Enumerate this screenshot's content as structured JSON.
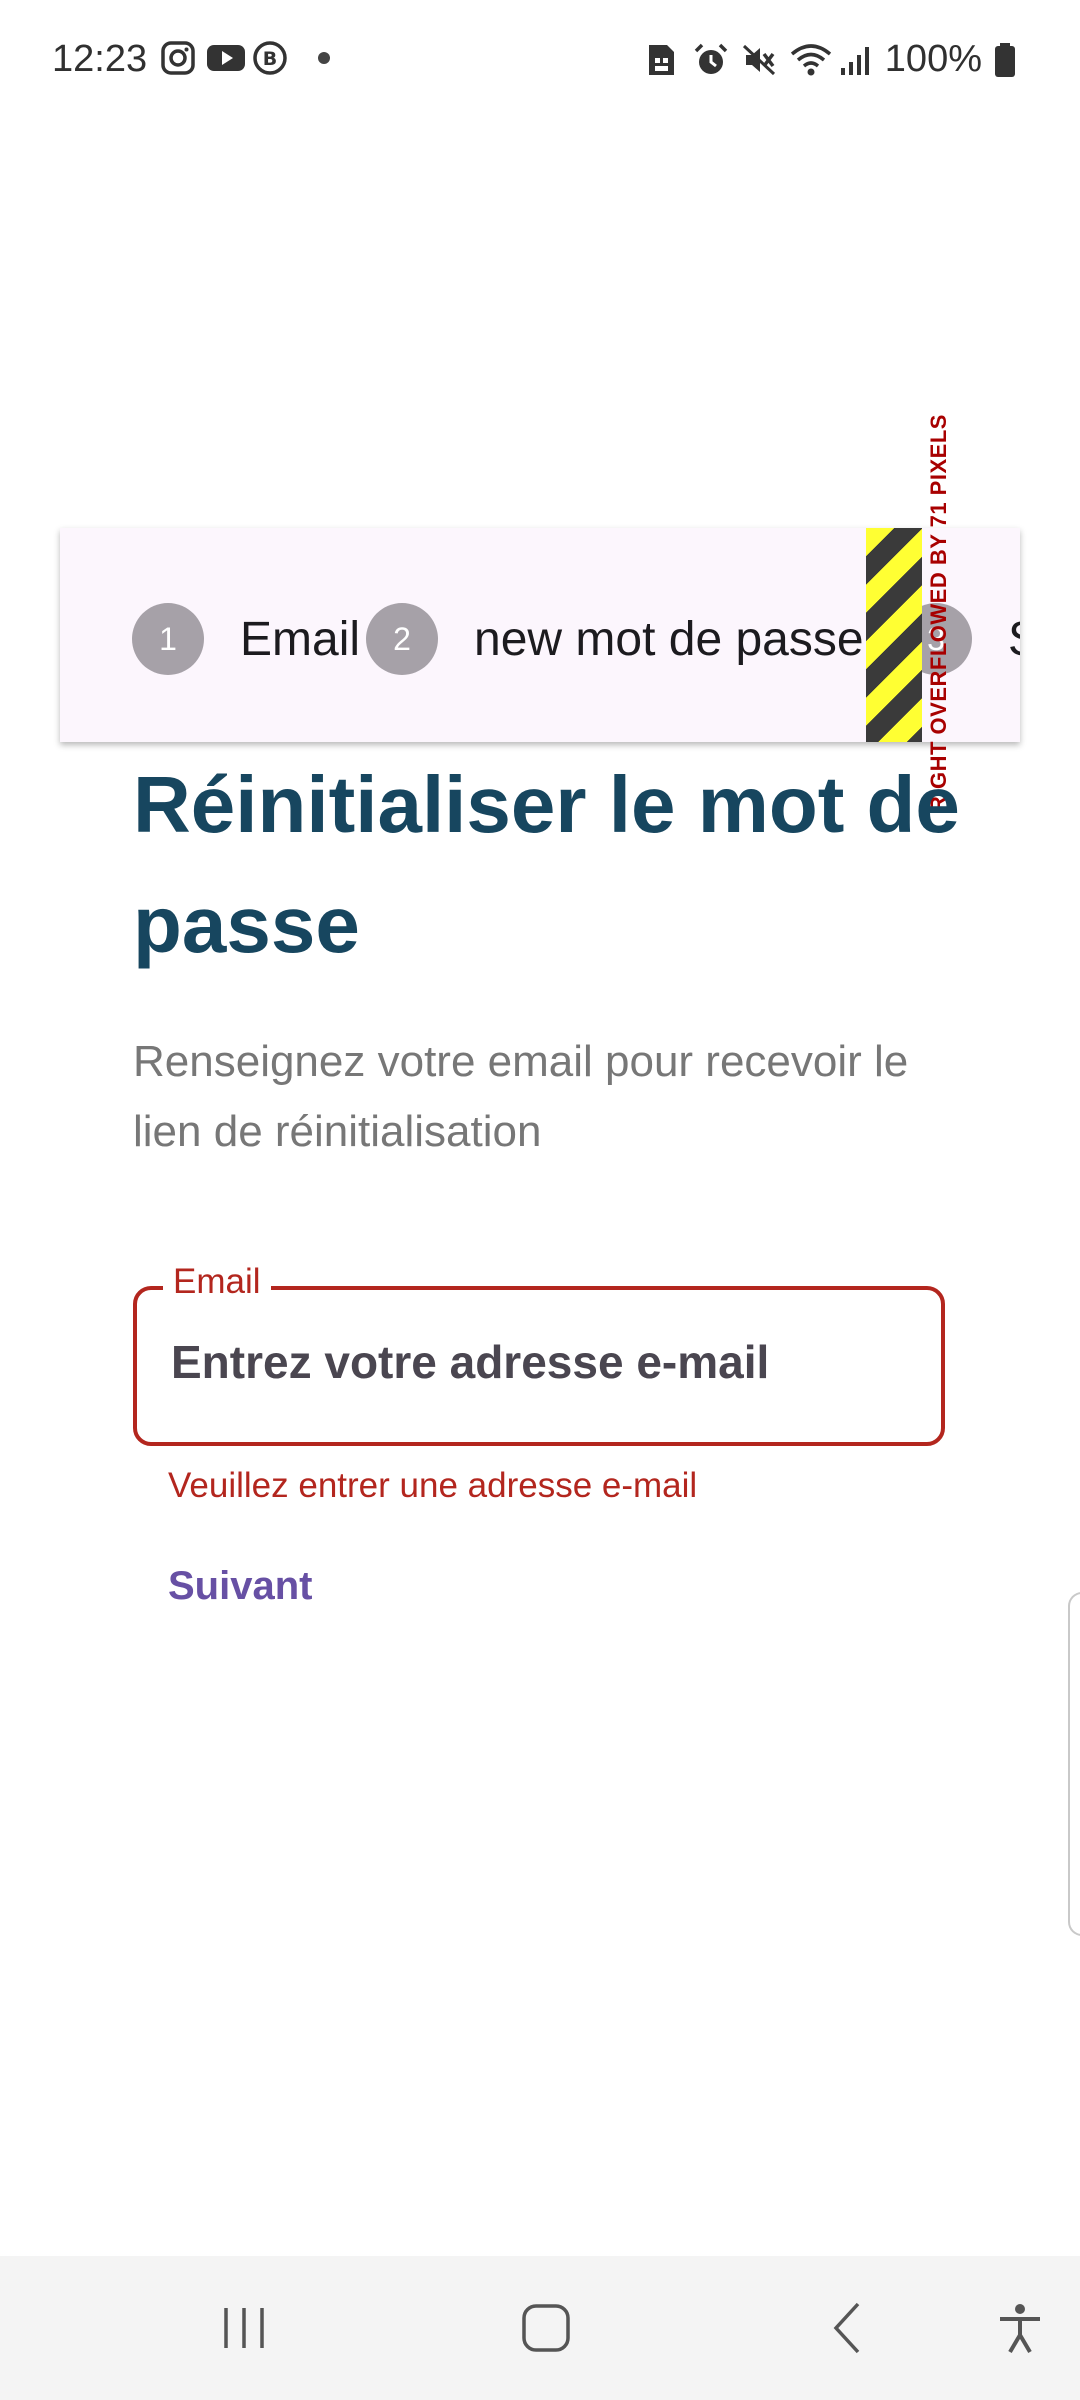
{
  "status_bar": {
    "time": "12:23",
    "battery_text": "100%",
    "left_icons": [
      "instagram-icon",
      "youtube-icon",
      "b-icon",
      "dot-icon"
    ],
    "right_icons": [
      "sim-icon",
      "alarm-icon",
      "mute-icon",
      "wifi-icon",
      "signal-icon",
      "battery-icon"
    ]
  },
  "stepper": {
    "steps": [
      {
        "number": "1",
        "label": "Email"
      },
      {
        "number": "2",
        "label": "new mot de passe"
      },
      {
        "number": "3",
        "label": "Suc"
      }
    ],
    "overflow_warning": "RIGHT OVERFLOWED BY 71 PIXELS"
  },
  "main": {
    "title": "Réinitialiser le mot de passe",
    "subtitle": "Renseignez votre email pour recevoir le lien de réinitialisation",
    "email_label": "Email",
    "email_placeholder": "Entrez votre adresse e-mail",
    "email_value": "",
    "error_text": "Veuillez entrer une adresse e-mail",
    "next_label": "Suivant"
  },
  "colors": {
    "title": "#17465f",
    "error": "#b3261e",
    "accent": "#6750a4",
    "step_circle": "#a6a1a8",
    "card_bg": "#fcf6fd"
  },
  "nav_bar": {
    "buttons": [
      "recent-apps-icon",
      "home-icon",
      "back-icon",
      "accessibility-icon"
    ]
  }
}
